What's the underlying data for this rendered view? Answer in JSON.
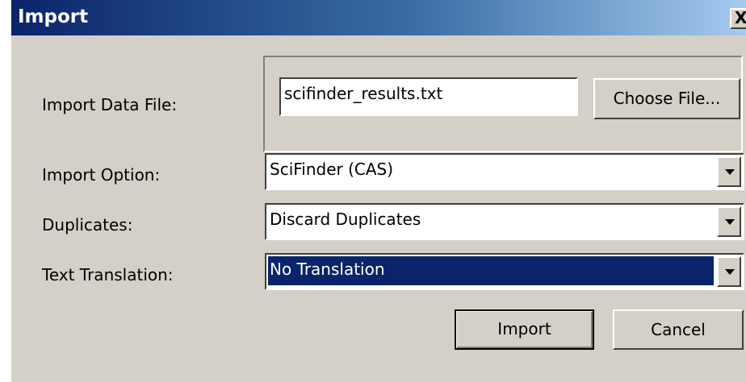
{
  "window": {
    "title": "Import",
    "close_glyph": "X"
  },
  "form": {
    "import_data_file": {
      "label": "Import Data File:",
      "value": "scifinder_results.txt",
      "choose_label": "Choose File..."
    },
    "import_option": {
      "label": "Import Option:",
      "value": "SciFinder (CAS)"
    },
    "duplicates": {
      "label": "Duplicates:",
      "value": "Discard Duplicates"
    },
    "text_translation": {
      "label": "Text Translation:",
      "value": "No Translation"
    }
  },
  "buttons": {
    "import": "Import",
    "cancel": "Cancel"
  },
  "icons": {
    "close": "close-icon",
    "dropdown": "chevron-down-icon"
  },
  "colors": {
    "title_start": "#0a246a",
    "title_end": "#a6caf0",
    "selection": "#0a246a",
    "face": "#d4d0c8"
  }
}
